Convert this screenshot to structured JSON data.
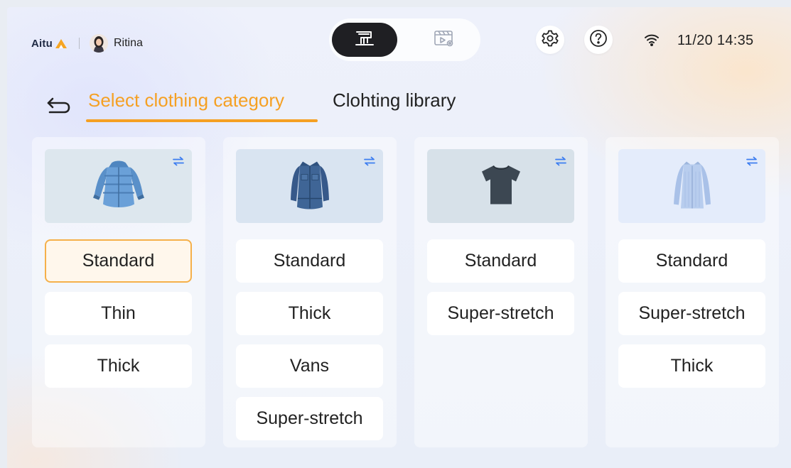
{
  "header": {
    "brand": "Aitu",
    "username": "Ritina",
    "datetime": "11/20 14:35",
    "modes": [
      {
        "icon": "sewing-machine-icon",
        "active": true
      },
      {
        "icon": "video-preview-icon",
        "active": false
      }
    ],
    "icons": [
      "settings-gear-icon",
      "help-icon",
      "wifi-icon"
    ]
  },
  "tabs": {
    "active": "Select clothing category",
    "inactive": "Clohting library"
  },
  "categories": [
    {
      "garment": "puffer-jacket",
      "options": [
        "Standard",
        "Thin",
        "Thick"
      ],
      "selected": "Standard"
    },
    {
      "garment": "denim-jacket",
      "options": [
        "Standard",
        "Thick",
        "Vans",
        "Super-stretch"
      ]
    },
    {
      "garment": "t-shirt",
      "options": [
        "Standard",
        "Super-stretch"
      ]
    },
    {
      "garment": "shirt",
      "options": [
        "Standard",
        "Super-stretch",
        "Thick"
      ]
    }
  ],
  "colors": {
    "accent": "#f5a023",
    "swap_icon": "#3c7df0",
    "dark_toggle": "#1f1f23"
  }
}
